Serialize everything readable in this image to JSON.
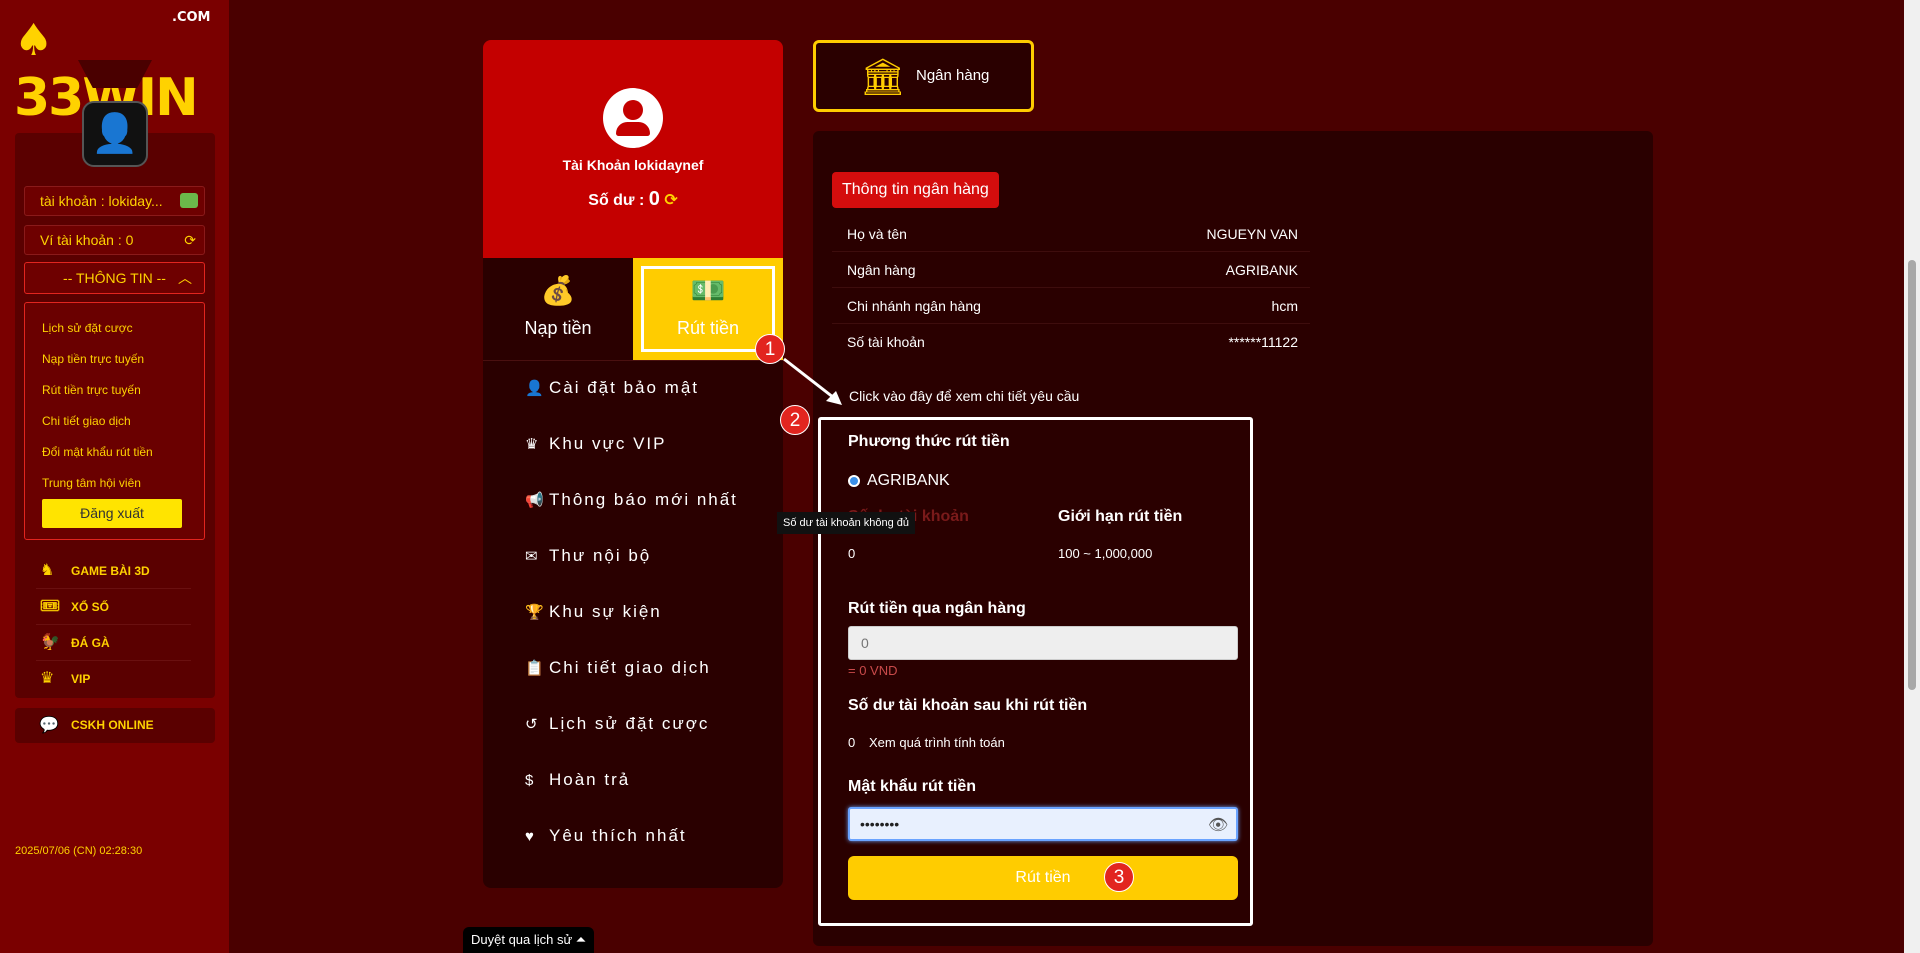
{
  "sidebar": {
    "logo": "33WIN",
    "logo_suffix": ".COM",
    "account_label": "tài khoản : lokiday...",
    "wallet_label": "Ví tài khoản : 0",
    "info_toggle": "-- THÔNG TIN --",
    "dropdown_items": [
      "Lịch sử đặt cược",
      "Nạp tiền trực tuyến",
      "Rút tiền trực tuyến",
      "Chi tiết giao dịch",
      "Đổi mật khẩu rút tiền",
      "Trung tâm hội viên"
    ],
    "logout": "Đăng xuất",
    "games": [
      "GAME BÀI 3D",
      "XỔ SỐ",
      "ĐÁ GÀ",
      "VIP"
    ],
    "cskh": "CSKH ONLINE",
    "datetime": "2025/07/06 (CN) 02:28:30"
  },
  "profile": {
    "account_name": "Tài Khoản lokidaynef",
    "balance_label": "Số dư :",
    "balance_value": "0"
  },
  "tabs": {
    "deposit": "Nạp tiền",
    "withdraw": "Rút tiền"
  },
  "menu": [
    "Cài đặt bảo mật",
    "Khu vực VIP",
    "Thông báo mới nhất",
    "Thư nội bộ",
    "Khu sự kiện",
    "Chi tiết giao dịch",
    "Lịch sử đặt cược",
    "Hoàn trả",
    "Yêu thích nhất"
  ],
  "tooltip": "Số dư tài khoản không đủ",
  "bank_tab": "Ngân hàng",
  "bank_info": {
    "badge": "Thông tin ngân hàng",
    "rows": [
      {
        "k": "Họ và tên",
        "v": "NGUEYN VAN"
      },
      {
        "k": "Ngân hàng",
        "v": "AGRIBANK"
      },
      {
        "k": "Chi nhánh ngân hàng",
        "v": "hcm"
      },
      {
        "k": "Số tài khoản",
        "v": "******11122"
      }
    ]
  },
  "click_hint": "Click vào đây để xem chi tiết yêu cầu",
  "withdraw": {
    "method_title": "Phương thức rút tiền",
    "method_option": "AGRIBANK",
    "balance_title": "Số dư tài khoản",
    "limit_title": "Giới hạn rút tiền",
    "balance_value": "0",
    "limit_value": "100 ~ 1,000,000",
    "bank_title": "Rút tiền qua ngân hàng",
    "amount_placeholder": "0",
    "vnd_text": "= 0 VND",
    "after_title": "Số dư tài khoản sau khi rút tiền",
    "after_value": "0",
    "after_link": "Xem quá trình tính toán",
    "pw_title": "Mật khẩu rút tiền",
    "pw_value": "••••••••",
    "submit": "Rút tiền"
  },
  "steps": [
    "1",
    "2",
    "3"
  ],
  "bottom_bar": "Duyệt qua lịch sử ⏶",
  "colors": {
    "accent": "#ffcc00",
    "brand_red": "#c40000",
    "bg": "#4a0000"
  }
}
